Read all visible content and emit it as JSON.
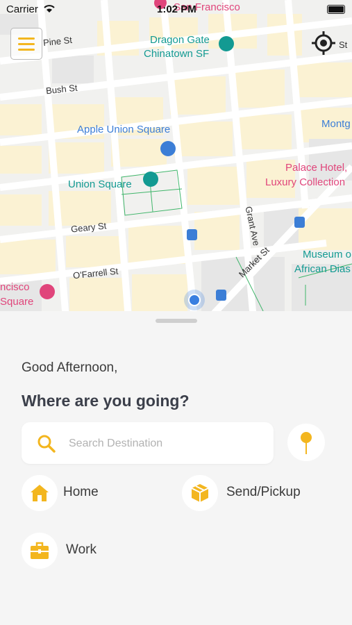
{
  "status_bar": {
    "carrier": "Carrier",
    "time": "1:02 PM"
  },
  "map": {
    "places": {
      "san_francisco": "San Francisco",
      "dragon_gate_line1": "Dragon Gate",
      "dragon_gate_line2": "Chinatown SF",
      "apple_union_square": "Apple Union Square",
      "union_square": "Union Square",
      "palace_hotel_line1": "Palace Hotel,",
      "palace_hotel_line2": "Luxury Collection",
      "museum_line1": "Museum o",
      "museum_line2": "African Dias",
      "montg": "Montg",
      "hotel_line1": "ncisco",
      "hotel_line2": "Square"
    },
    "streets": {
      "pine": "Pine St",
      "bush": "Bush St",
      "geary": "Geary St",
      "ofarrell": "O'Farrell St",
      "grant": "Grant Ave",
      "market": "Market St",
      "st_right": "St"
    },
    "colors": {
      "teal": "#139a92",
      "blue": "#3c7ed6",
      "pink": "#e0457b",
      "user_dot": "#3a7fe0"
    }
  },
  "sheet": {
    "greeting": "Good Afternoon,",
    "question": "Where are you going?",
    "search": {
      "placeholder": "Search Destination",
      "value": ""
    },
    "shortcuts": [
      {
        "label": "Home",
        "icon": "home-icon"
      },
      {
        "label": "Send/Pickup",
        "icon": "package-icon"
      },
      {
        "label": "Work",
        "icon": "briefcase-icon"
      }
    ],
    "accent_color": "#f3b61f"
  }
}
